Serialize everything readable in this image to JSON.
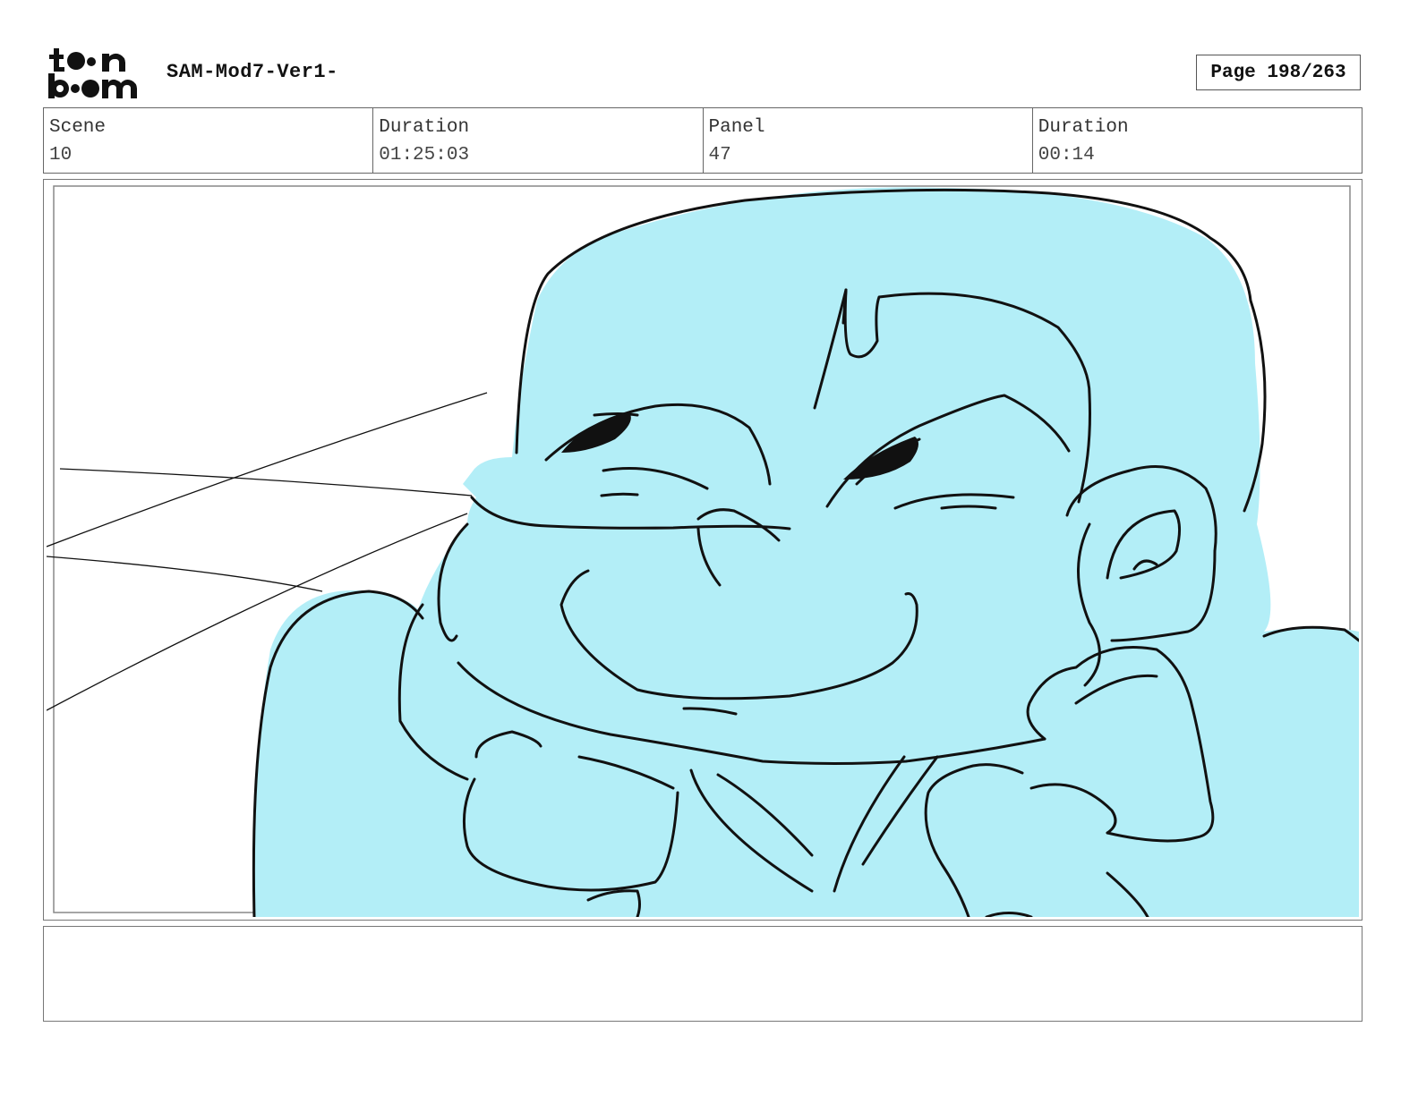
{
  "header": {
    "logo_name": "toonboom-logo",
    "document_title": "SAM-Mod7-Ver1-",
    "page_indicator": "Page 198/263"
  },
  "info": {
    "scene_label": "Scene",
    "scene_value": "10",
    "scene_duration_label": "Duration",
    "scene_duration_value": "01:25:03",
    "panel_label": "Panel",
    "panel_value": "47",
    "panel_duration_label": "Duration",
    "panel_duration_value": "00:14"
  },
  "panel": {
    "fill_color": "#b3eef7",
    "line_color": "#111111"
  },
  "dialogue": {
    "text": ""
  }
}
